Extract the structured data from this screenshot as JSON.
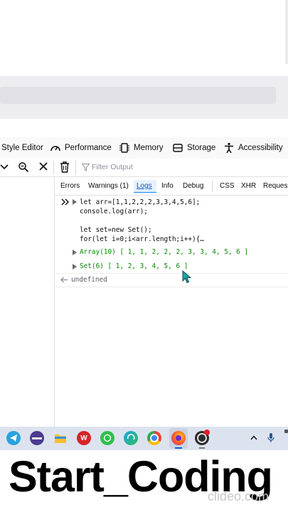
{
  "devtools": {
    "tabs": [
      {
        "label": "Style Editor",
        "icon": "style-editor-icon"
      },
      {
        "label": "Performance",
        "icon": "performance-icon"
      },
      {
        "label": "Memory",
        "icon": "memory-icon"
      },
      {
        "label": "Storage",
        "icon": "storage-icon"
      },
      {
        "label": "Accessibility",
        "icon": "accessibility-icon"
      }
    ]
  },
  "console": {
    "filter_placeholder": "Filter Output",
    "filter_tabs": [
      "Errors",
      "Warnings (1)",
      "Logs",
      "Info",
      "Debug",
      "CSS",
      "XHR",
      "Reques"
    ],
    "active_filter": "Logs",
    "input_lines": [
      "let arr=[1,1,2,2,2,3,3,4,5,6];",
      "console.log(arr);",
      "",
      "let set=new Set();",
      "for(let i=0;i<arr.length;i++){…"
    ],
    "outputs": [
      "Array(10) [ 1, 1, 2, 2, 2, 3, 3, 4, 5, 6 ]",
      "Set(6) [ 1, 2, 3, 4, 5, 6 ]"
    ],
    "return_value": "undefined"
  },
  "taskbar": {
    "apps": [
      "telegram-icon",
      "winrar-icon",
      "file-explorer-icon",
      "wps-office-icon",
      "whatsapp-icon",
      "edge-icon",
      "chrome-icon",
      "firefox-icon",
      "obs-icon"
    ]
  },
  "banner": {
    "title": "Start_Coding",
    "watermark": "clideo.com"
  },
  "colors": {
    "output_green": "#058b00",
    "accent_blue": "#0a84ff",
    "taskbar_bg": "#dde3ee"
  }
}
